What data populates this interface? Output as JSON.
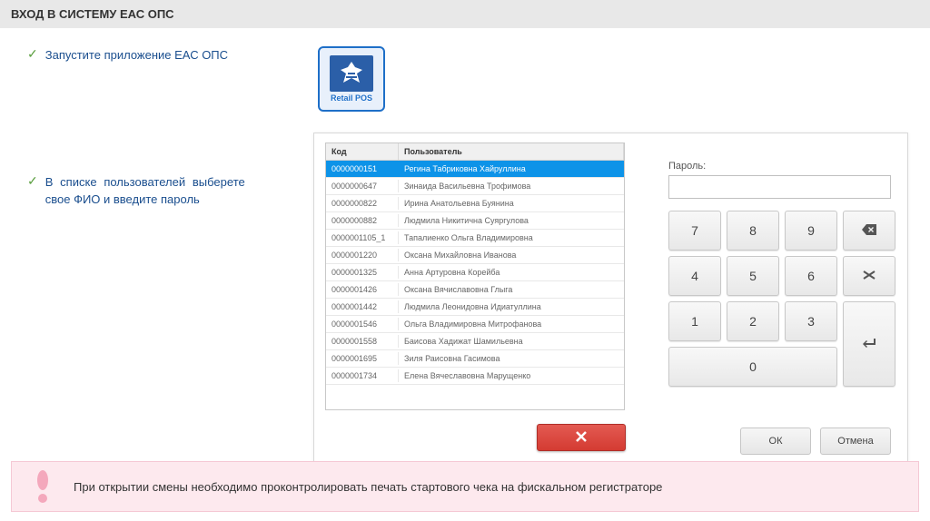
{
  "header": {
    "title": "ВХОД В СИСТЕМУ ЕАС ОПС"
  },
  "instructions": {
    "step1": "Запустите приложение ЕАС ОПС",
    "step2": "В списке пользователей выберете свое ФИО и введите пароль"
  },
  "appIcon": {
    "label": "Retail POS"
  },
  "userTable": {
    "headers": {
      "code": "Код",
      "name": "Пользователь"
    },
    "rows": [
      {
        "code": "0000000151",
        "name": "Регина Табриковна Хайруллина",
        "selected": true
      },
      {
        "code": "0000000647",
        "name": "Зинаида Васильевна Трофимова"
      },
      {
        "code": "0000000822",
        "name": "Ирина Анатольевна Буянина"
      },
      {
        "code": "0000000882",
        "name": "Людмила Никитична Суяргулова"
      },
      {
        "code": "0000001105_1",
        "name": "Тапалиенко Ольга Владимировна"
      },
      {
        "code": "0000001220",
        "name": "Оксана Михайловна Иванова"
      },
      {
        "code": "0000001325",
        "name": "Анна Артуровна Корейба"
      },
      {
        "code": "0000001426",
        "name": "Оксана Вячиславовна Глыга"
      },
      {
        "code": "0000001442",
        "name": "Людмила Леонидовна Идиатуллина"
      },
      {
        "code": "0000001546",
        "name": "Ольга Владимировна Митрофанова"
      },
      {
        "code": "0000001558",
        "name": "Баисова Хадижат Шамильевна"
      },
      {
        "code": "0000001695",
        "name": "Зиля Раисовна Гасимова"
      },
      {
        "code": "0000001734",
        "name": "Елена Вячеславовна Марущенко"
      }
    ]
  },
  "password": {
    "label": "Пароль:"
  },
  "keypad": {
    "k7": "7",
    "k8": "8",
    "k9": "9",
    "k4": "4",
    "k5": "5",
    "k6": "6",
    "k1": "1",
    "k2": "2",
    "k3": "3",
    "k0": "0"
  },
  "buttons": {
    "ok": "ОК",
    "cancel": "Отмена"
  },
  "footer": {
    "message": "При открытии смены необходимо проконтролировать печать стартового чека на фискальном регистраторе"
  }
}
